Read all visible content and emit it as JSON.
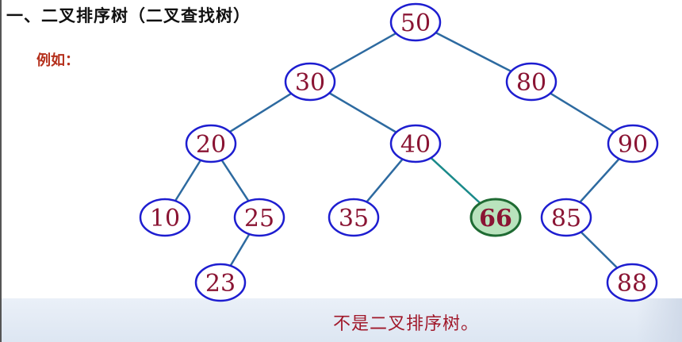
{
  "title": "一、二叉排序树（二叉查找树）",
  "example_label": "例如：",
  "caption": "不是二叉排序树。",
  "colors": {
    "node_border": "#1d1dd0",
    "node_text": "#8a1433",
    "edge": "#2d6aa0",
    "edge_highlight": "#1a8a8a",
    "highlight_fill": "#b9e3bd",
    "highlight_border": "#1f6b33",
    "highlight_text": "#1f6b33"
  },
  "tree": {
    "nodes": [
      {
        "id": "n50",
        "value": "50"
      },
      {
        "id": "n30",
        "value": "30"
      },
      {
        "id": "n80",
        "value": "80"
      },
      {
        "id": "n20",
        "value": "20"
      },
      {
        "id": "n40",
        "value": "40"
      },
      {
        "id": "n90",
        "value": "90"
      },
      {
        "id": "n10",
        "value": "10"
      },
      {
        "id": "n25",
        "value": "25"
      },
      {
        "id": "n35",
        "value": "35"
      },
      {
        "id": "n66",
        "value": "66",
        "highlighted": true
      },
      {
        "id": "n85",
        "value": "85"
      },
      {
        "id": "n23",
        "value": "23"
      },
      {
        "id": "n88",
        "value": "88"
      }
    ],
    "edges": [
      {
        "from": "n50",
        "to": "n30"
      },
      {
        "from": "n50",
        "to": "n80"
      },
      {
        "from": "n30",
        "to": "n20"
      },
      {
        "from": "n30",
        "to": "n40"
      },
      {
        "from": "n80",
        "to": "n90"
      },
      {
        "from": "n20",
        "to": "n10"
      },
      {
        "from": "n20",
        "to": "n25"
      },
      {
        "from": "n40",
        "to": "n35"
      },
      {
        "from": "n40",
        "to": "n66",
        "highlighted": true
      },
      {
        "from": "n90",
        "to": "n85"
      },
      {
        "from": "n25",
        "to": "n23"
      },
      {
        "from": "n85",
        "to": "n88"
      }
    ]
  }
}
